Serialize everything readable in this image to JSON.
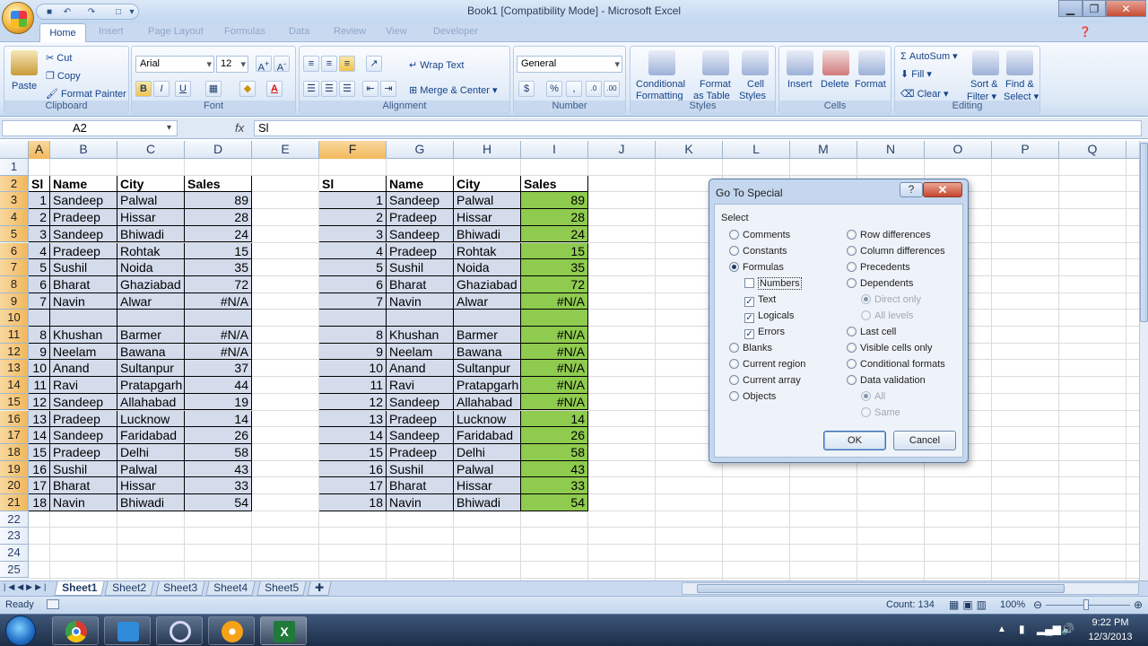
{
  "window": {
    "title": "Book1  [Compatibility Mode] - Microsoft Excel",
    "min": "▁",
    "max": "❐",
    "close": "✕"
  },
  "ribbon_tabs": [
    "Home",
    "Insert",
    "Page Layout",
    "Formulas",
    "Data",
    "Review",
    "View",
    "Developer"
  ],
  "clipboard": {
    "paste": "Paste",
    "cut": "Cut",
    "copy": "Copy",
    "format_painter": "Format Painter",
    "group": "Clipboard"
  },
  "font": {
    "name": "Arial",
    "size": "12",
    "group": "Font",
    "bold": "B",
    "italic": "I",
    "underline": "U"
  },
  "alignment": {
    "wrap": "Wrap Text",
    "merge": "Merge & Center",
    "group": "Alignment"
  },
  "number": {
    "format": "General",
    "currency": "$",
    "percent": "%",
    "comma": ",",
    "group": "Number"
  },
  "styles": {
    "conditional": "Conditional",
    "conditional2": "Formatting",
    "format_table": "Format",
    "format_table2": "as Table",
    "cell_styles": "Cell",
    "cell_styles2": "Styles",
    "group": "Styles"
  },
  "cells_grp": {
    "insert": "Insert",
    "delete": "Delete",
    "format": "Format",
    "group": "Cells"
  },
  "editing": {
    "autosum": "AutoSum",
    "fill": "Fill",
    "clear": "Clear",
    "sort": "Sort &",
    "sort2": "Filter",
    "find": "Find &",
    "find2": "Select",
    "group": "Editing"
  },
  "formula_bar": {
    "name_box": "A2",
    "fx": "fx",
    "content": "Sl"
  },
  "columns": [
    "A",
    "B",
    "C",
    "D",
    "E",
    "F",
    "G",
    "H",
    "I",
    "J",
    "K",
    "L",
    "M",
    "N",
    "O",
    "P",
    "Q"
  ],
  "rows": [
    "1",
    "2",
    "3",
    "4",
    "5",
    "6",
    "7",
    "8",
    "9",
    "10",
    "11",
    "12",
    "13",
    "14",
    "15",
    "16",
    "17",
    "18",
    "19",
    "20",
    "21",
    "22",
    "23",
    "24",
    "25"
  ],
  "table1": {
    "header": [
      "Sl",
      "Name",
      "City",
      "Sales"
    ],
    "rows": [
      [
        "1",
        "Sandeep",
        "Palwal",
        "89"
      ],
      [
        "2",
        "Pradeep",
        "Hissar",
        "28"
      ],
      [
        "3",
        "Sandeep",
        "Bhiwadi",
        "24"
      ],
      [
        "4",
        "Pradeep",
        "Rohtak",
        "15"
      ],
      [
        "5",
        "Sushil",
        "Noida",
        "35"
      ],
      [
        "6",
        "Bharat",
        "Ghaziabad",
        "72"
      ],
      [
        "7",
        "Navin",
        "Alwar",
        "#N/A"
      ],
      [
        "",
        "",
        "",
        ""
      ],
      [
        "8",
        "Khushan",
        "Barmer",
        "#N/A"
      ],
      [
        "9",
        "Neelam",
        "Bawana",
        "#N/A"
      ],
      [
        "10",
        "Anand",
        "Sultanpur",
        "37"
      ],
      [
        "11",
        "Ravi",
        "Pratapgarh",
        "44"
      ],
      [
        "12",
        "Sandeep",
        "Allahabad",
        "19"
      ],
      [
        "13",
        "Pradeep",
        "Lucknow",
        "14"
      ],
      [
        "14",
        "Sandeep",
        "Faridabad",
        "26"
      ],
      [
        "15",
        "Pradeep",
        "Delhi",
        "58"
      ],
      [
        "16",
        "Sushil",
        "Palwal",
        "43"
      ],
      [
        "17",
        "Bharat",
        "Hissar",
        "33"
      ],
      [
        "18",
        "Navin",
        "Bhiwadi",
        "54"
      ]
    ]
  },
  "table2": {
    "header": [
      "Sl",
      "Name",
      "City",
      "Sales"
    ],
    "rows": [
      [
        "1",
        "Sandeep",
        "Palwal",
        "89"
      ],
      [
        "2",
        "Pradeep",
        "Hissar",
        "28"
      ],
      [
        "3",
        "Sandeep",
        "Bhiwadi",
        "24"
      ],
      [
        "4",
        "Pradeep",
        "Rohtak",
        "15"
      ],
      [
        "5",
        "Sushil",
        "Noida",
        "35"
      ],
      [
        "6",
        "Bharat",
        "Ghaziabad",
        "72"
      ],
      [
        "7",
        "Navin",
        "Alwar",
        "#N/A"
      ],
      [
        "",
        "",
        "",
        ""
      ],
      [
        "8",
        "Khushan",
        "Barmer",
        "#N/A"
      ],
      [
        "9",
        "Neelam",
        "Bawana",
        "#N/A"
      ],
      [
        "10",
        "Anand",
        "Sultanpur",
        "#N/A"
      ],
      [
        "11",
        "Ravi",
        "Pratapgarh",
        "#N/A"
      ],
      [
        "12",
        "Sandeep",
        "Allahabad",
        "#N/A"
      ],
      [
        "13",
        "Pradeep",
        "Lucknow",
        "14"
      ],
      [
        "14",
        "Sandeep",
        "Faridabad",
        "26"
      ],
      [
        "15",
        "Pradeep",
        "Delhi",
        "58"
      ],
      [
        "16",
        "Sushil",
        "Palwal",
        "43"
      ],
      [
        "17",
        "Bharat",
        "Hissar",
        "33"
      ],
      [
        "18",
        "Navin",
        "Bhiwadi",
        "54"
      ]
    ]
  },
  "dialog": {
    "title": "Go To Special",
    "help": "?",
    "close": "✕",
    "section": "Select",
    "left": [
      "Comments",
      "Constants",
      "Formulas",
      "Numbers",
      "Text",
      "Logicals",
      "Errors",
      "Blanks",
      "Current region",
      "Current array",
      "Objects"
    ],
    "right": [
      "Row differences",
      "Column differences",
      "Precedents",
      "Dependents",
      "Direct only",
      "All levels",
      "Last cell",
      "Visible cells only",
      "Conditional formats",
      "Data validation",
      "All",
      "Same"
    ],
    "ok": "OK",
    "cancel": "Cancel"
  },
  "sheets": [
    "Sheet1",
    "Sheet2",
    "Sheet3",
    "Sheet4",
    "Sheet5"
  ],
  "status": {
    "ready": "Ready",
    "count": "Count: 134",
    "zoom": "100%"
  },
  "taskbar": {
    "time": "9:22 PM",
    "date": "12/3/2013"
  },
  "colors": {
    "selected_header": "#f1b75b",
    "blue_fill": "#d4dcec",
    "green_fill": "#8fcb4f"
  }
}
